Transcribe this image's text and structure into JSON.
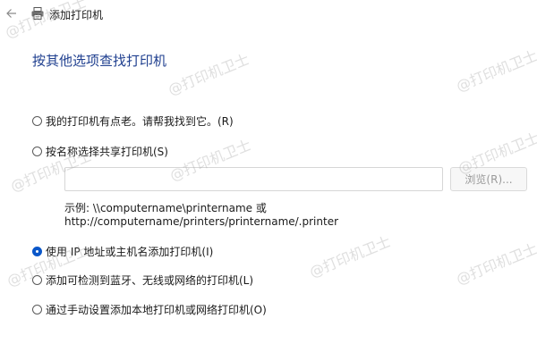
{
  "window": {
    "title": "添加打印机",
    "back_icon": "back-arrow-icon",
    "printer_icon": "printer-icon"
  },
  "page": {
    "title": "按其他选项查找打印机"
  },
  "options": [
    {
      "label": "我的打印机有点老。请帮我找到它。(R)",
      "checked": false
    },
    {
      "label": "按名称选择共享打印机(S)",
      "checked": false
    },
    {
      "label": "使用 IP 地址或主机名添加打印机(I)",
      "checked": true
    },
    {
      "label": "添加可检测到蓝牙、无线或网络的打印机(L)",
      "checked": false
    },
    {
      "label": "通过手动设置添加本地打印机或网络打印机(O)",
      "checked": false
    }
  ],
  "shared_printer": {
    "input_value": "",
    "browse_label": "浏览(R)...",
    "example_line1": "示例: \\\\computername\\printername 或",
    "example_line2": "http://computername/printers/printername/.printer"
  },
  "watermark": {
    "text": "@打印机卫士"
  },
  "colors": {
    "accent": "#0a57c9",
    "title": "#1f3f8f"
  }
}
